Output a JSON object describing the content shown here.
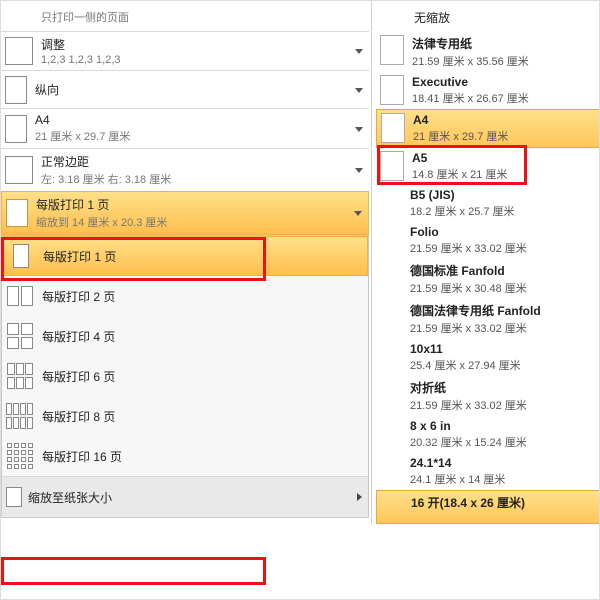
{
  "left": {
    "one_side": "只打印一侧的页面",
    "collate_t": "调整",
    "collate_s": "1,2,3    1,2,3    1,2,3",
    "orient": "纵向",
    "paper_t": "A4",
    "paper_s": "21 厘米 x 29.7 厘米",
    "margin_t": "正常边距",
    "margin_s": "左: 3.18 厘米   右: 3.18 厘米",
    "pps_t": "每版打印 1 页",
    "pps_s": "缩放到 14 厘米 x 20.3 厘米"
  },
  "menu": {
    "items": [
      {
        "t": "每版打印 1 页"
      },
      {
        "t": "每版打印 2 页"
      },
      {
        "t": "每版打印 4 页"
      },
      {
        "t": "每版打印 6 页"
      },
      {
        "t": "每版打印 8 页"
      },
      {
        "t": "每版打印 16 页"
      }
    ],
    "footer": "缩放至纸张大小"
  },
  "right": {
    "head": "无缩放",
    "papers": [
      {
        "t": "法律专用纸",
        "s": "21.59 厘米 x 35.56 厘米",
        "icon": true
      },
      {
        "t": "Executive",
        "s": "18.41 厘米 x 26.67 厘米",
        "icon": true
      },
      {
        "t": "A4",
        "s": "21 厘米 x 29.7 厘米",
        "icon": true,
        "hl": true
      },
      {
        "t": "A5",
        "s": "14.8 厘米 x 21 厘米",
        "icon": true
      },
      {
        "t": "B5 (JIS)",
        "s": "18.2 厘米 x 25.7 厘米",
        "icon": false
      },
      {
        "t": "Folio",
        "s": "21.59 厘米 x 33.02 厘米",
        "icon": false
      },
      {
        "t": "德国标准 Fanfold",
        "s": "21.59 厘米 x 30.48 厘米",
        "icon": false
      },
      {
        "t": "德国法律专用纸 Fanfold",
        "s": "21.59 厘米 x 33.02 厘米",
        "icon": false
      },
      {
        "t": "10x11",
        "s": "25.4 厘米 x 27.94 厘米",
        "icon": false
      },
      {
        "t": "对折纸",
        "s": "21.59 厘米 x 33.02 厘米",
        "icon": false
      },
      {
        "t": "8 x 6 in",
        "s": "20.32 厘米 x 15.24 厘米",
        "icon": false
      },
      {
        "t": "24.1*14",
        "s": "24.1 厘米 x 14 厘米",
        "icon": false
      },
      {
        "t": "16 开(18.4 x 26 厘米)",
        "s": "",
        "icon": false,
        "hl": true
      }
    ]
  }
}
